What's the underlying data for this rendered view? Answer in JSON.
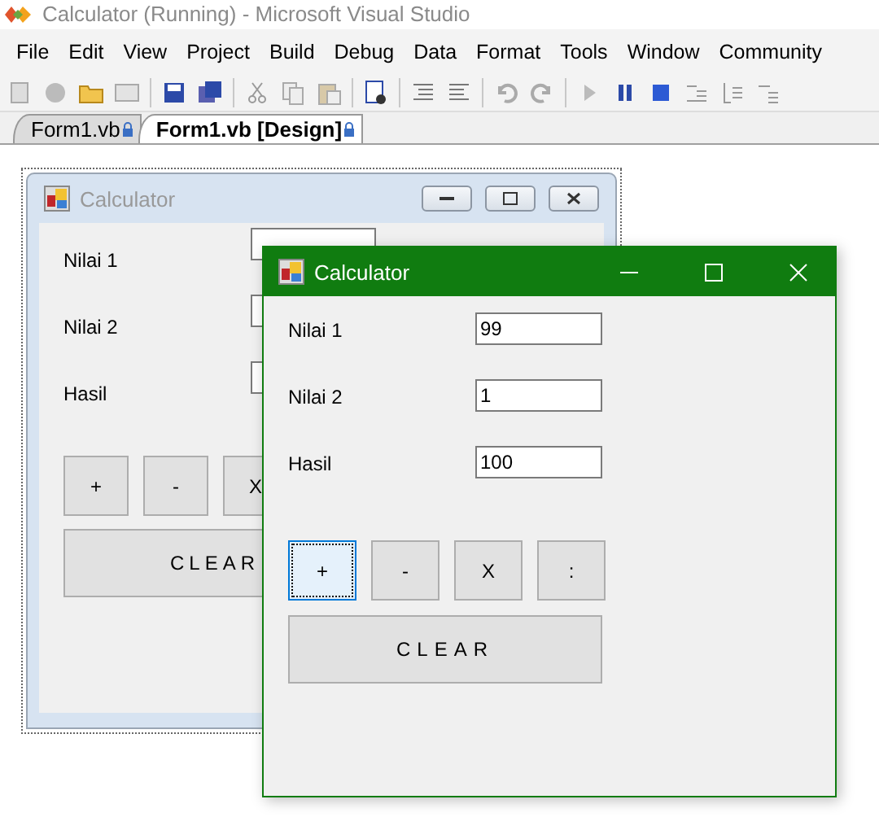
{
  "app_window": {
    "title": "Calculator (Running) - Microsoft Visual Studio"
  },
  "menu": [
    {
      "label": "File"
    },
    {
      "label": "Edit"
    },
    {
      "label": "View"
    },
    {
      "label": "Project"
    },
    {
      "label": "Build"
    },
    {
      "label": "Debug"
    },
    {
      "label": "Data"
    },
    {
      "label": "Format"
    },
    {
      "label": "Tools"
    },
    {
      "label": "Window"
    },
    {
      "label": "Community"
    }
  ],
  "document_tabs": [
    {
      "label": "Form1.vb",
      "selected": false
    },
    {
      "label": "Form1.vb [Design]",
      "selected": true
    }
  ],
  "design_form": {
    "title": "Calculator",
    "fields": [
      {
        "label": "Nilai 1"
      },
      {
        "label": "Nilai 2"
      },
      {
        "label": "Hasil"
      }
    ],
    "buttons": [
      {
        "label": "+"
      },
      {
        "label": "-"
      },
      {
        "label": "X"
      }
    ],
    "clear_button": "CLEAR"
  },
  "running_form": {
    "title": "Calculator",
    "fields": [
      {
        "label": "Nilai 1",
        "value": "99"
      },
      {
        "label": "Nilai 2",
        "value": "1"
      },
      {
        "label": "Hasil",
        "value": "100"
      }
    ],
    "buttons": [
      {
        "label": "+",
        "focused": true
      },
      {
        "label": "-",
        "focused": false
      },
      {
        "label": "X",
        "focused": false
      },
      {
        "label": ":",
        "focused": false
      }
    ],
    "clear_button": "CLEAR"
  }
}
